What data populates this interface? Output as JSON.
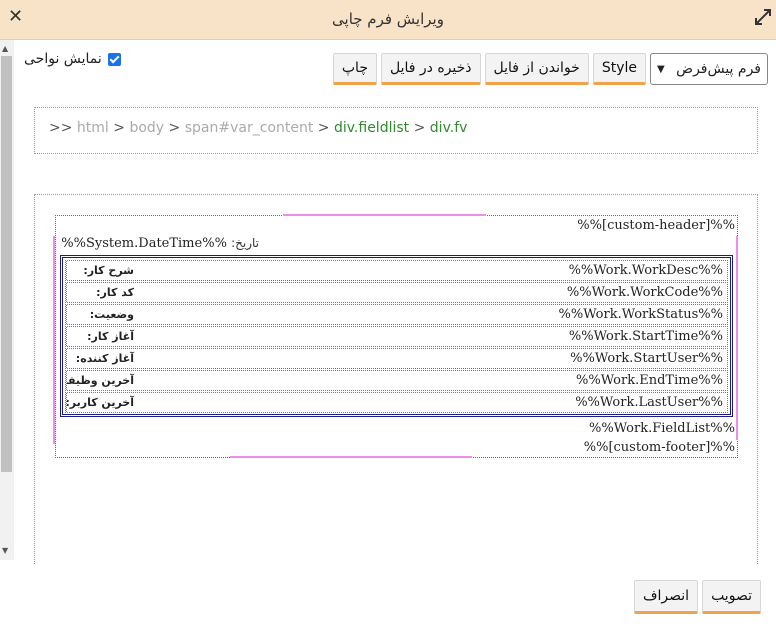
{
  "dialog": {
    "title": "ویرایش فرم چاپی"
  },
  "toolbar": {
    "template_select": "فرم پیش‌فرض",
    "style_label": "Style",
    "load_label": "خواندن از فایل",
    "save_label": "ذخیره در فایل",
    "print_label": "چاپ"
  },
  "show_regions": {
    "label": "نمایش نواحی",
    "checked": true
  },
  "breadcrumb": {
    "prefix": ">>",
    "sep": ">",
    "items": [
      "html",
      "body",
      "span#var_content",
      "div.fieldlist",
      "div.fv"
    ]
  },
  "form": {
    "header": "%%[custom-header]%%",
    "date_label": "تاریخ:",
    "date_value": "%%System.DateTime%%",
    "fields": [
      {
        "label": "شرح کار:",
        "value": "%%Work.WorkDesc%%"
      },
      {
        "label": "کد کار:",
        "value": "%%Work.WorkCode%%"
      },
      {
        "label": "وضعیت:",
        "value": "%%Work.WorkStatus%%"
      },
      {
        "label": "آغاز کار:",
        "value": "%%Work.StartTime%%"
      },
      {
        "label": "آغاز کننده:",
        "value": "%%Work.StartUser%%"
      },
      {
        "label": "آخرین وظیفه:",
        "value": "%%Work.EndTime%%"
      },
      {
        "label": "آخرین کاربر:",
        "value": "%%Work.LastUser%%"
      }
    ],
    "fieldlist": "%%Work.FieldList%%",
    "footer": "%%[custom-footer]%%"
  },
  "actions": {
    "confirm_label": "تصویب",
    "cancel_label": "انصراف"
  },
  "colors": {
    "titlebar": "#f8e3c8",
    "button_accent": "#f0a24a",
    "breadcrumb_active": "#2e8b2e",
    "region_highlight": "#f08cf0"
  }
}
